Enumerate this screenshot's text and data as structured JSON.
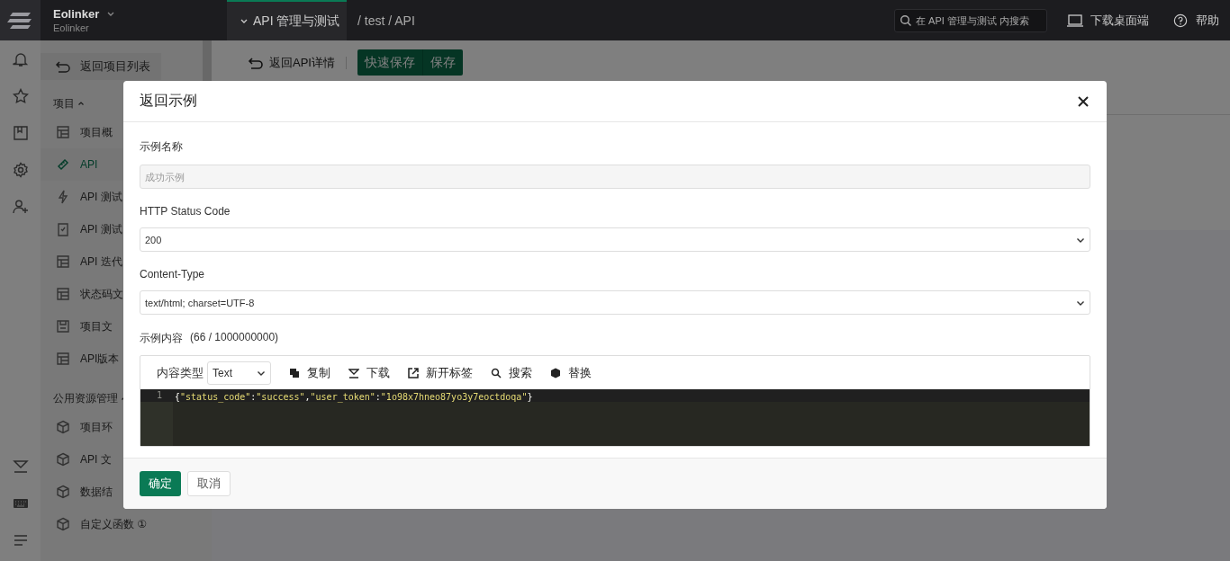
{
  "topbar": {
    "brand": "Eolinker",
    "brand_sub": "Eolinker",
    "module_tab": "API 管理与测试",
    "breadcrumb": "/ test / API",
    "search": {
      "placeholder": "在 API 管理与测试 内搜索"
    },
    "actions": [
      "下载桌面端",
      "帮助"
    ]
  },
  "toolbar": {
    "back": "返回API详情",
    "buttons": [
      "快速保存",
      "保存"
    ]
  },
  "sidebar": {
    "back": "返回项目列表",
    "sections": [
      {
        "title": "项目",
        "expanded": true,
        "items": [
          {
            "label": "项目概",
            "selected": false
          },
          {
            "label": "API",
            "selected": true
          },
          {
            "label": "API 测试",
            "selected": false
          },
          {
            "label": "API 测试",
            "selected": false
          },
          {
            "label": "API 迭代",
            "selected": false
          },
          {
            "label": "状态码文",
            "selected": false
          },
          {
            "label": "项目文",
            "selected": false
          },
          {
            "label": "API版本",
            "selected": false
          }
        ]
      },
      {
        "title": "公用资源管理",
        "expanded": true,
        "items": [
          {
            "label": "项目环",
            "selected": false
          },
          {
            "label": "API 文",
            "selected": false
          },
          {
            "label": "数据结",
            "selected": false
          },
          {
            "label": "自定义函数 ①",
            "selected": false
          }
        ]
      }
    ]
  },
  "modal": {
    "title": "返回示例",
    "fields": [
      {
        "label": "示例名称",
        "kind": "input",
        "placeholder": "成功示例",
        "disabled": true
      },
      {
        "label": "HTTP Status Code",
        "kind": "select",
        "value": "200"
      },
      {
        "label": "Content-Type",
        "kind": "select",
        "value": "text/html; charset=UTF-8"
      }
    ],
    "editor": {
      "label": "示例内容",
      "count": "(66 / 1000000000)",
      "type_label": "内容类型",
      "type_value": "Text",
      "tools": [
        "复制",
        "下载",
        "新开标签",
        "搜索",
        "替换"
      ],
      "lines": [
        {
          "number": "1",
          "text": "{\"status_code\":\"success\",\"user_token\":\"1o98x7hneo87yo3y7eoctdoqa\"}"
        }
      ]
    },
    "buttons": [
      {
        "label": "确定",
        "kind": "primary"
      },
      {
        "label": "取消",
        "kind": "default"
      }
    ]
  }
}
